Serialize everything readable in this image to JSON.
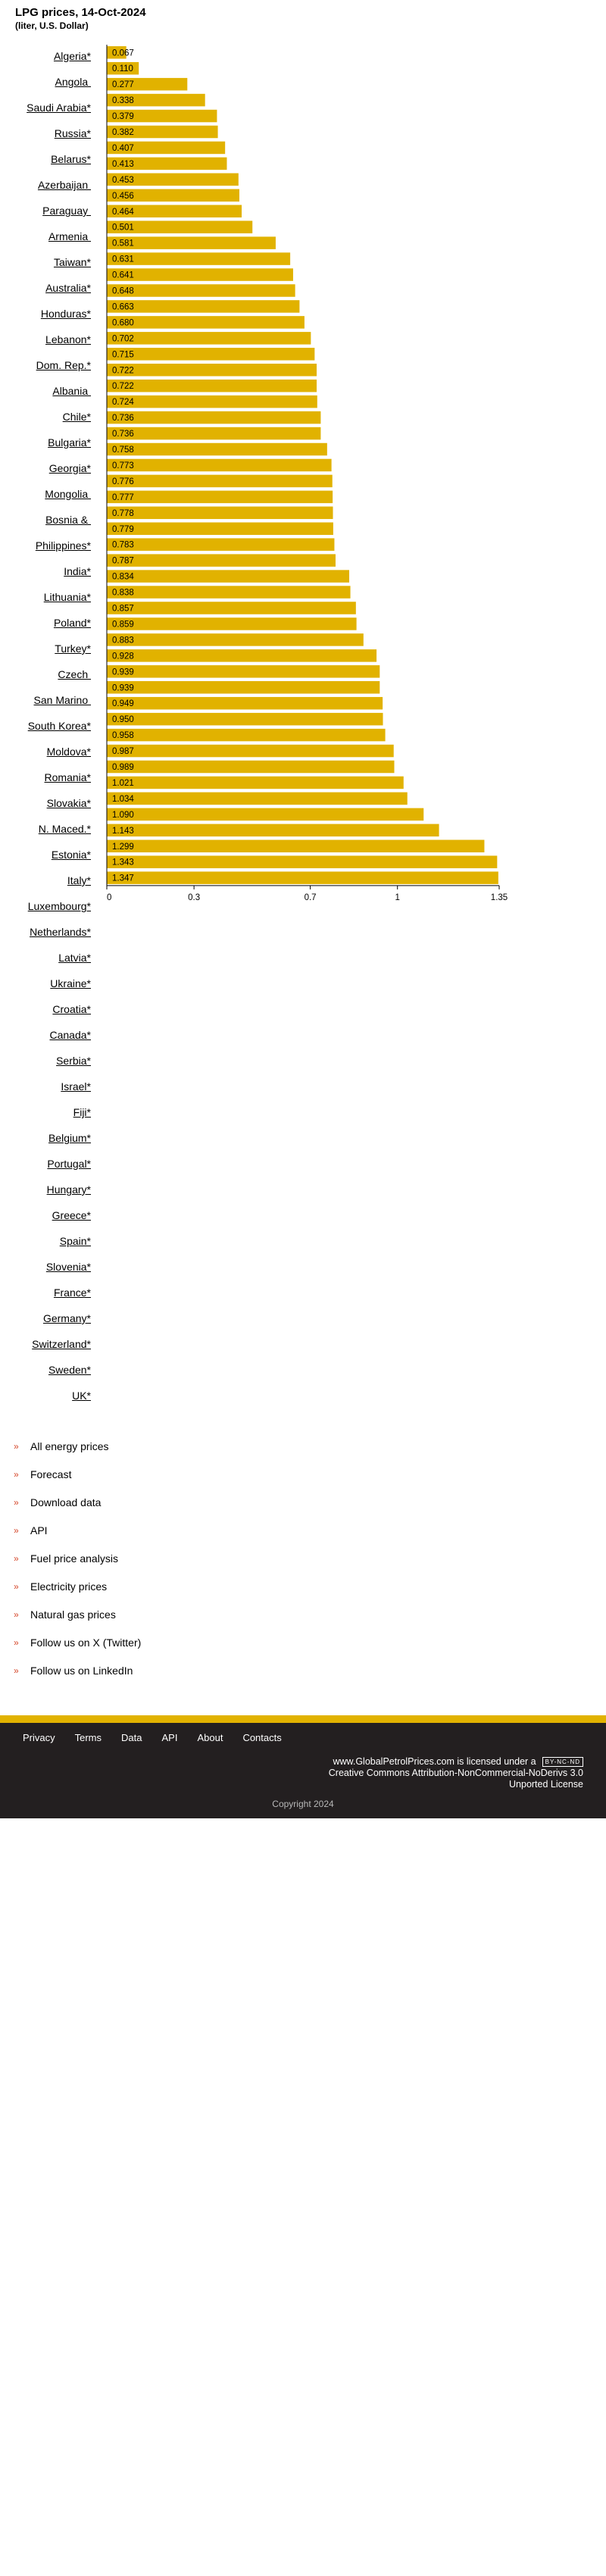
{
  "header": {
    "title": "LPG prices, 14-Oct-2024",
    "subtitle": "(liter, U.S. Dollar)"
  },
  "countries": [
    "Algeria*",
    "Angola ",
    "Saudi Arabia*",
    "Russia*",
    "Belarus*",
    "Azerbaijan ",
    "Paraguay ",
    "Armenia ",
    "Taiwan*",
    "Australia*",
    "Honduras*",
    "Lebanon*",
    "Dom. Rep.*",
    "Albania ",
    "Chile*",
    "Bulgaria*",
    "Georgia*",
    "Mongolia ",
    "Bosnia & ",
    "Philippines*",
    "India*",
    "Lithuania*",
    "Poland*",
    "Turkey*",
    "Czech ",
    "San Marino ",
    "South Korea*",
    "Moldova*",
    "Romania*",
    "Slovakia*",
    "N. Maced.*",
    "Estonia*",
    "Italy*",
    "Luxembourg*",
    "Netherlands*",
    "Latvia*",
    "Ukraine*",
    "Croatia*",
    "Canada*",
    "Serbia*",
    "Israel*",
    "Fiji*",
    "Belgium*",
    "Portugal*",
    "Hungary*",
    "Greece*",
    "Spain*",
    "Slovenia*",
    "France*",
    "Germany*",
    "Switzerland*",
    "Sweden*",
    "UK*"
  ],
  "chart_data": {
    "type": "bar",
    "orientation": "horizontal",
    "title": "LPG prices, 14-Oct-2024",
    "subtitle": "(liter, U.S. Dollar)",
    "values": [
      0.067,
      0.11,
      0.277,
      0.338,
      0.379,
      0.382,
      0.407,
      0.413,
      0.453,
      0.456,
      0.464,
      0.501,
      0.581,
      0.631,
      0.641,
      0.648,
      0.663,
      0.68,
      0.702,
      0.715,
      0.722,
      0.722,
      0.724,
      0.736,
      0.736,
      0.758,
      0.773,
      0.776,
      0.777,
      0.778,
      0.779,
      0.783,
      0.787,
      0.834,
      0.838,
      0.857,
      0.859,
      0.883,
      0.928,
      0.939,
      0.939,
      0.949,
      0.95,
      0.958,
      0.987,
      0.989,
      1.021,
      1.034,
      1.09,
      1.143,
      1.299,
      1.343,
      1.347
    ],
    "value_labels": [
      "0.067",
      "0.110",
      "0.277",
      "0.338",
      "0.379",
      "0.382",
      "0.407",
      "0.413",
      "0.453",
      "0.456",
      "0.464",
      "0.501",
      "0.581",
      "0.631",
      "0.641",
      "0.648",
      "0.663",
      "0.680",
      "0.702",
      "0.715",
      "0.722",
      "0.722",
      "0.724",
      "0.736",
      "0.736",
      "0.758",
      "0.773",
      "0.776",
      "0.777",
      "0.778",
      "0.779",
      "0.783",
      "0.787",
      "0.834",
      "0.838",
      "0.857",
      "0.859",
      "0.883",
      "0.928",
      "0.939",
      "0.939",
      "0.949",
      "0.950",
      "0.958",
      "0.987",
      "0.989",
      "1.021",
      "1.034",
      "1.090",
      "1.143",
      "1.299",
      "1.343",
      "1.347"
    ],
    "x_ticks": [
      0,
      0.3,
      0.7,
      1,
      1.35
    ],
    "x_tick_labels": [
      "0",
      "0.3",
      "0.7",
      "1",
      "1.35"
    ],
    "xlim": [
      0,
      1.35
    ],
    "grid": false,
    "legend": "none",
    "bar_color": "#e1b200",
    "axis_color": "#000000"
  },
  "links": [
    "All energy prices",
    "Forecast",
    "Download data",
    "API",
    "Fuel price analysis",
    "Electricity prices",
    "Natural gas prices",
    "Follow us on X (Twitter)",
    "Follow us on LinkedIn"
  ],
  "footer": {
    "nav": [
      "Privacy",
      "Terms",
      "Data",
      "API",
      "About",
      "Contacts"
    ],
    "license_line1": "www.GlobalPetrolPrices.com is licensed under a",
    "license_line2": "Creative Commons Attribution-NonCommercial-NoDerivs 3.0",
    "license_line3": "Unported License",
    "cc_badge": "BY-NC-ND",
    "copyright": "Copyright 2024"
  },
  "colors": {
    "accent": "#e1b200",
    "bullet": "#d5472a",
    "footer_bg": "#231f20"
  }
}
